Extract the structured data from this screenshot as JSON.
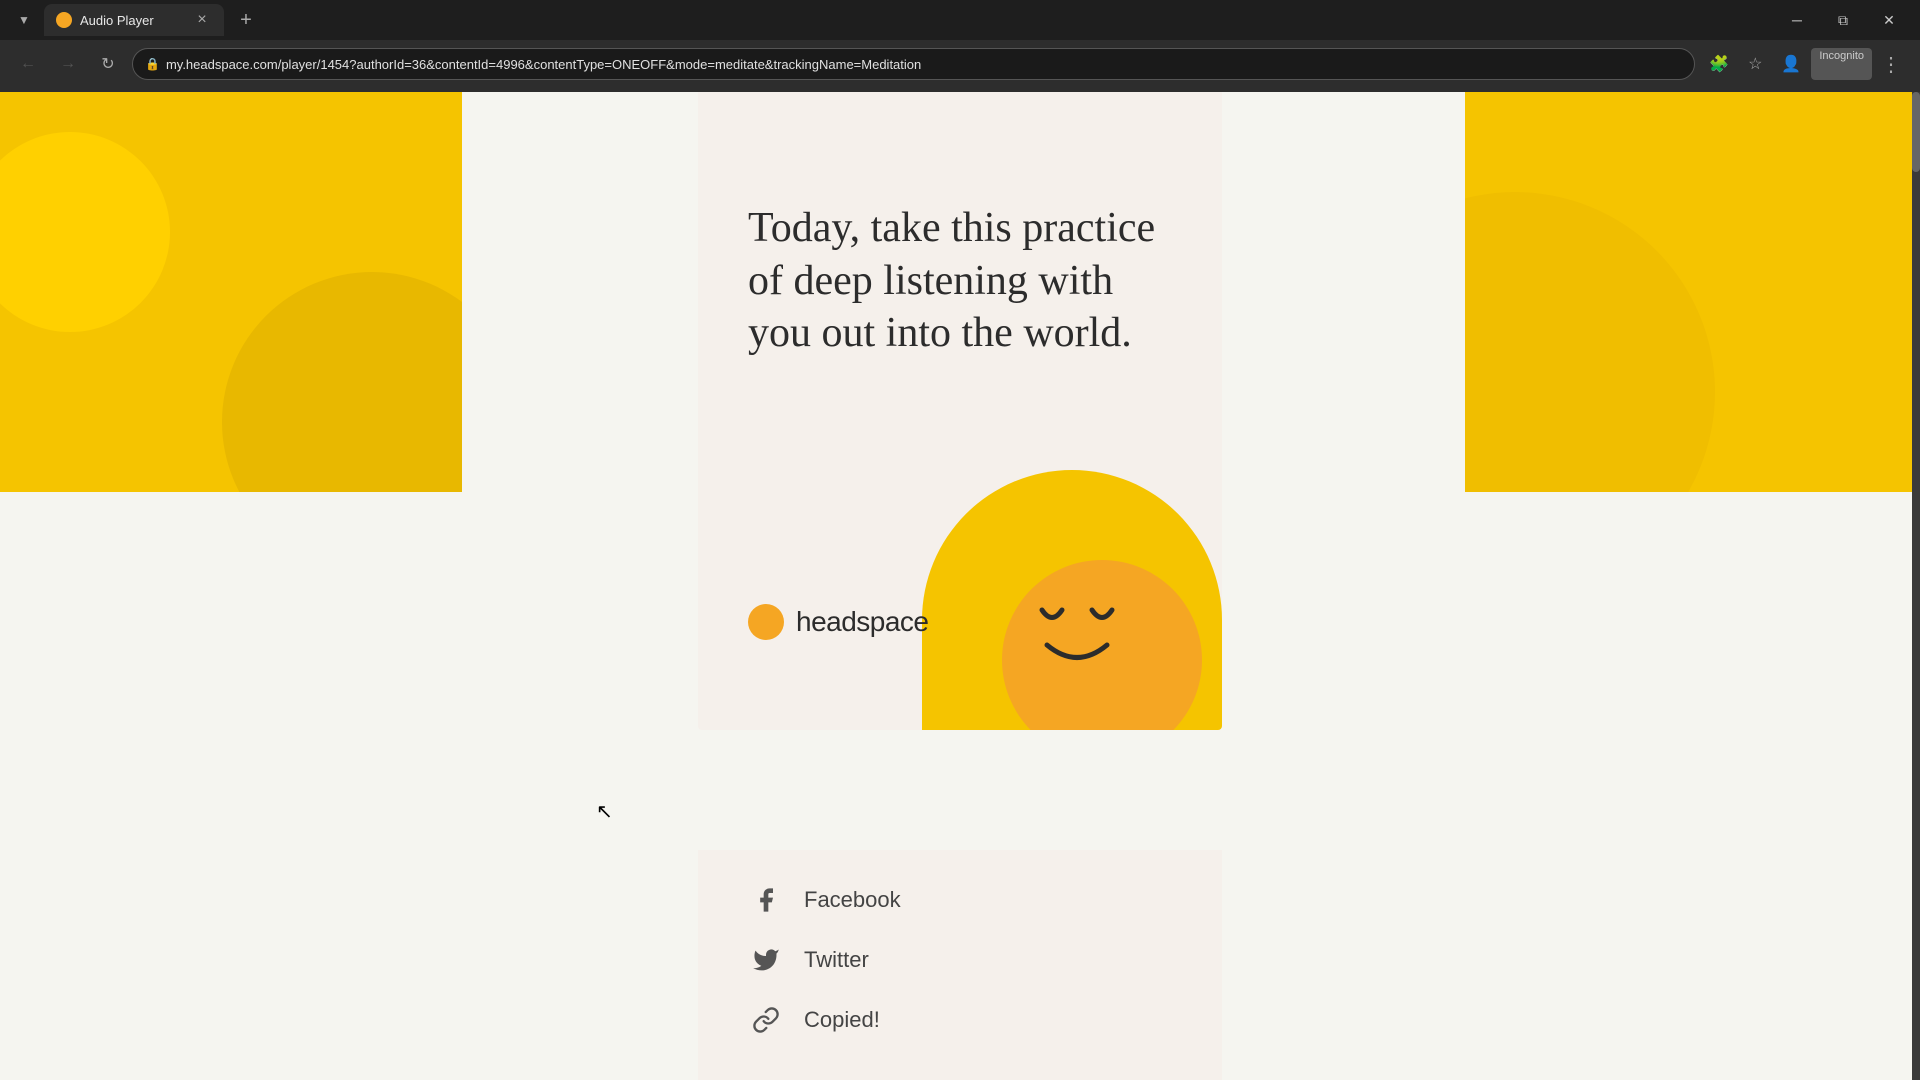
{
  "browser": {
    "tab_title": "Audio Player",
    "url": "my.headspace.com/player/1454?authorId=36&contentId=4996&contentType=ONEOFF&mode=meditate&trackingName=Meditation",
    "incognito_label": "Incognito",
    "new_tab_label": "+"
  },
  "page": {
    "quote": "Today, take this practice of deep listening with you out into the world.",
    "brand_name": "headspace",
    "social_links": [
      {
        "id": "facebook",
        "label": "Facebook",
        "icon": "f-icon"
      },
      {
        "id": "twitter",
        "label": "Twitter",
        "icon": "twitter-icon"
      },
      {
        "id": "copied",
        "label": "Copied!",
        "icon": "link-icon"
      }
    ]
  },
  "nav": {
    "back_label": "←",
    "forward_label": "→",
    "reload_label": "↻",
    "bookmark_label": "☆",
    "menu_label": "⋮"
  }
}
